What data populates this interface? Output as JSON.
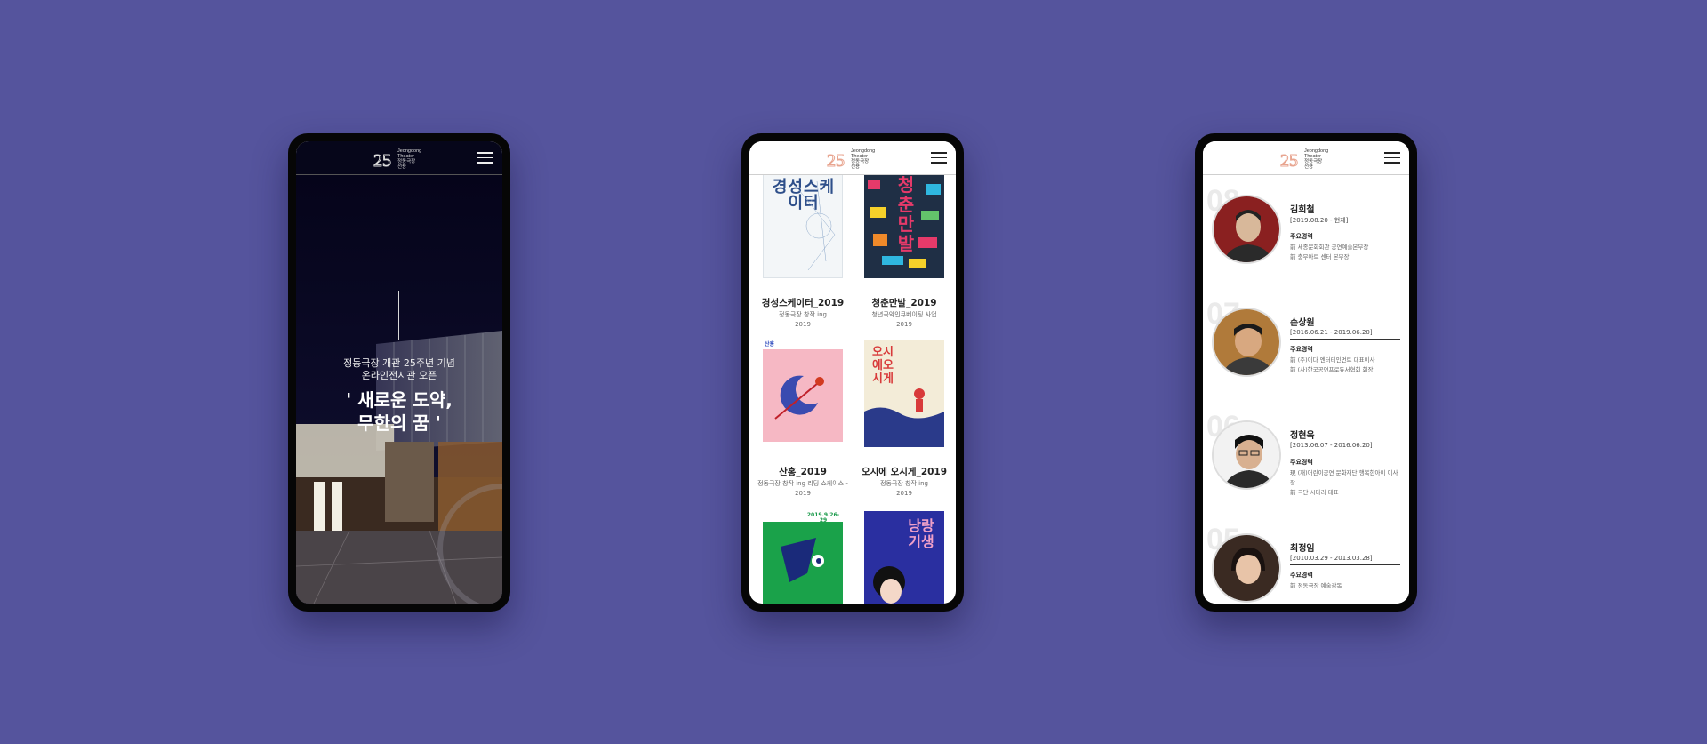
{
  "brand": {
    "line1": "Jeongdong",
    "line2": "Theater",
    "line3": "정동극장",
    "line4": "전용"
  },
  "colors": {
    "background": "#55549d",
    "logo_accent": "#e8a590",
    "hero_bg": "#07061c"
  },
  "phone_home": {
    "subtitle_line1": "정동극장 개관 25주년 기념",
    "subtitle_line2": "온라인전시관 오픈",
    "title_line1": "' 새로운 도약,",
    "title_line2": "무한의 꿈 '"
  },
  "phone_gallery": {
    "items": [
      {
        "title": "경성스케이터_2019",
        "meta": "정동극장 창작 ing",
        "year": "2019",
        "poster_text": "경성스케이터"
      },
      {
        "title": "청춘만발_2019",
        "meta": "청년국악인큐베이팅 사업",
        "year": "2019",
        "poster_text": "청춘만발"
      },
      {
        "title": "산홍_2019",
        "meta": "정동극장 창작 ing 리딩 쇼케이스 -",
        "year": "2019",
        "poster_text": "산홍"
      },
      {
        "title": "오시에 오시게_2019",
        "meta": "정동극장 창작 ing",
        "year": "2019",
        "poster_text": "오시에오시게"
      },
      {
        "title": "",
        "meta": "",
        "year": "",
        "poster_text": "2019.9.26-29"
      },
      {
        "title": "",
        "meta": "",
        "year": "",
        "poster_text": "낭랑기생"
      }
    ]
  },
  "phone_people": {
    "career_label": "주요경력",
    "people": [
      {
        "number": "08",
        "name": "김희철",
        "period": "2019.08.20 - 현재",
        "careers": [
          "前 세종문화회관 공연예술본부장",
          "前 충무아트 센터 본부장"
        ]
      },
      {
        "number": "07",
        "name": "손상원",
        "period": "2016.06.21 - 2019.06.20",
        "careers": [
          "前 (주)이다 엔터테인먼트 대표이사",
          "前 (사)한국공연프로듀서협회 회장"
        ]
      },
      {
        "number": "06",
        "name": "정현욱",
        "period": "2013.06.07 - 2016.06.20",
        "careers": [
          "現 (재)어린이공연 문화재단 행복한아이 이사장",
          "前 극단 시다리 대표"
        ]
      },
      {
        "number": "05",
        "name": "최정임",
        "period": "2010.03.29 - 2013.03.28",
        "careers": [
          "前 정동극장 예술감독"
        ]
      }
    ]
  }
}
